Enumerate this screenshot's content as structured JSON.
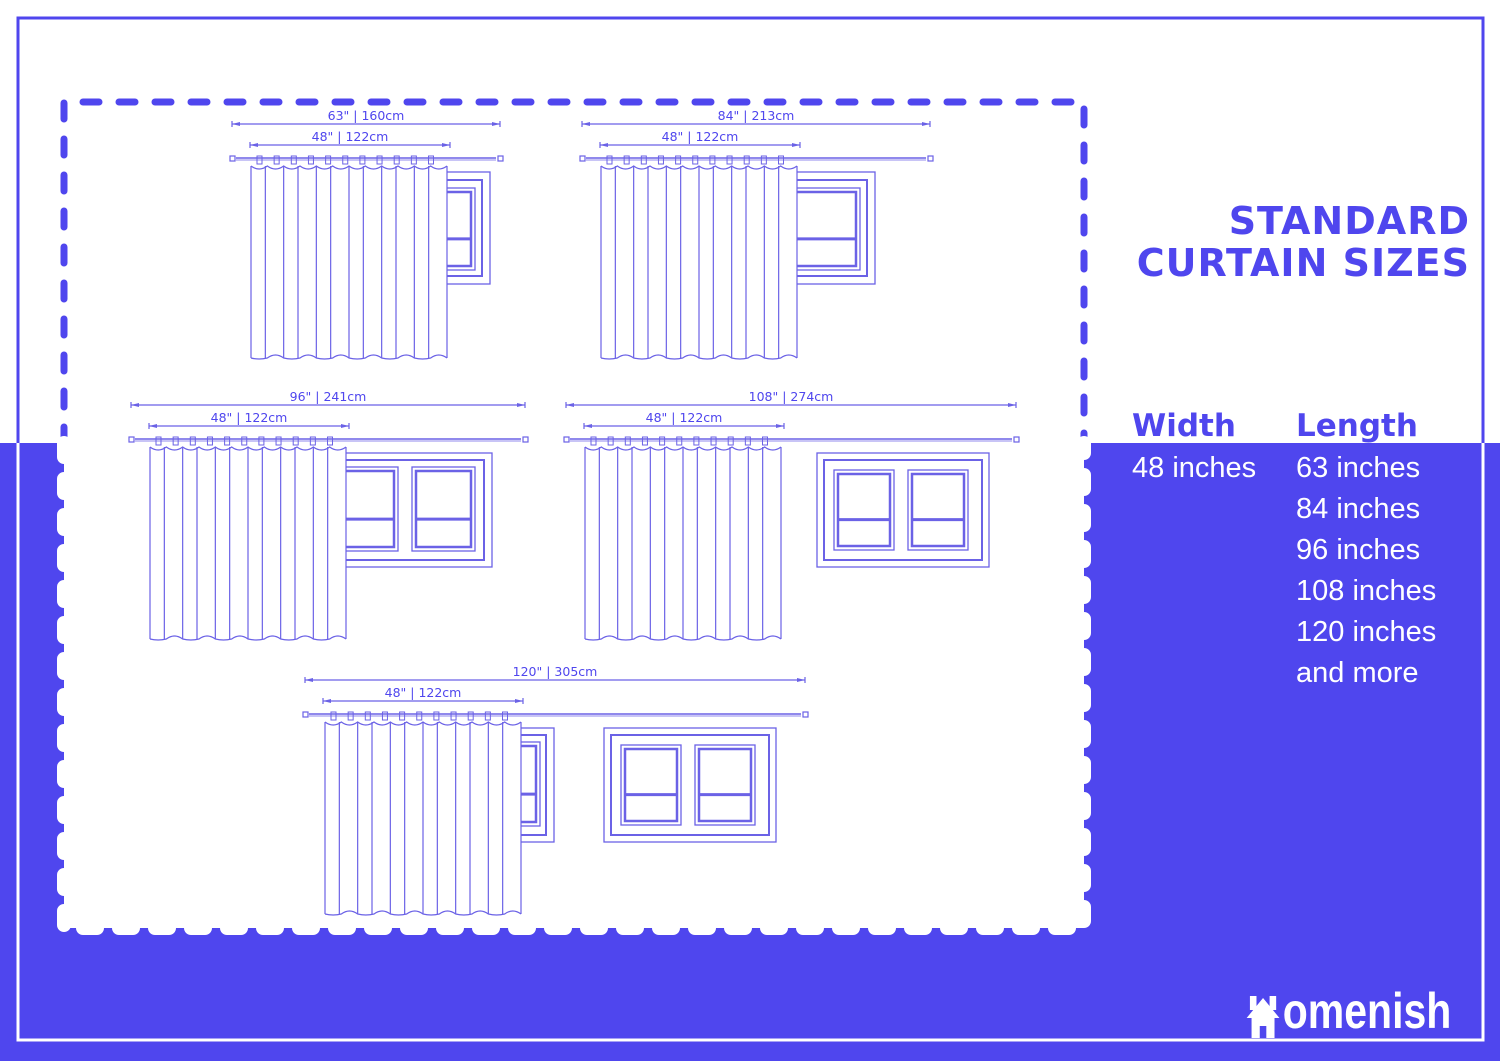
{
  "title": {
    "line1": "STANDARD",
    "line2": "CURTAIN SIZES"
  },
  "table": {
    "width_header": "Width",
    "length_header": "Length",
    "width_values": [
      "48 inches"
    ],
    "length_values": [
      "63 inches",
      "84 inches",
      "96 inches",
      "108 inches",
      "120 inches",
      "and more"
    ]
  },
  "diagrams": [
    {
      "name": "rod-63",
      "rod_label": "63\" | 160cm",
      "panel_label": "48\" | 122cm",
      "windows": "single-partial"
    },
    {
      "name": "rod-84",
      "rod_label": "84\" | 213cm",
      "panel_label": "48\" | 122cm",
      "windows": "single"
    },
    {
      "name": "rod-96",
      "rod_label": "96\" | 241cm",
      "panel_label": "48\" | 122cm",
      "windows": "double-partial"
    },
    {
      "name": "rod-108",
      "rod_label": "108\" | 274cm",
      "panel_label": "48\" | 122cm",
      "windows": "double"
    },
    {
      "name": "rod-120",
      "rod_label": "120\" | 305cm",
      "panel_label": "48\" | 122cm",
      "windows": "single-partial-plus-double"
    }
  ],
  "brand": {
    "name": "omenish",
    "icon": "house-icon"
  },
  "colors": {
    "accent": "#4f46ee",
    "line": "#6b62e6",
    "background": "#ffffff"
  }
}
